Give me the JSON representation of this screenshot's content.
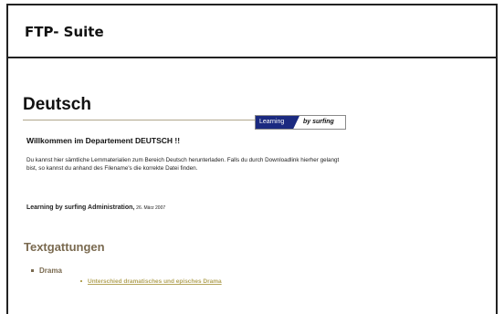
{
  "header": {
    "title": "FTP- Suite"
  },
  "page": {
    "title": "Deutsch",
    "banner": {
      "left": "Learning",
      "right": "by surfing"
    },
    "welcome": "Willkommen im Departement DEUTSCH !!",
    "description": "Du kannst hier sämtliche Lernmaterialien zum Bereich Deutsch herunterladen. Falls du durch Downloadlink hierher gelangt bist, so kannst du anhand des Filename's die korrekte Datei finden.",
    "admin_name": "Learning by surfing Administration,",
    "admin_date": "26. März 2007"
  },
  "textgattungen": {
    "title": "Textgattungen",
    "items": [
      {
        "label": "Drama",
        "links": [
          "Unterschied dramatisches und episches Drama"
        ]
      }
    ]
  }
}
